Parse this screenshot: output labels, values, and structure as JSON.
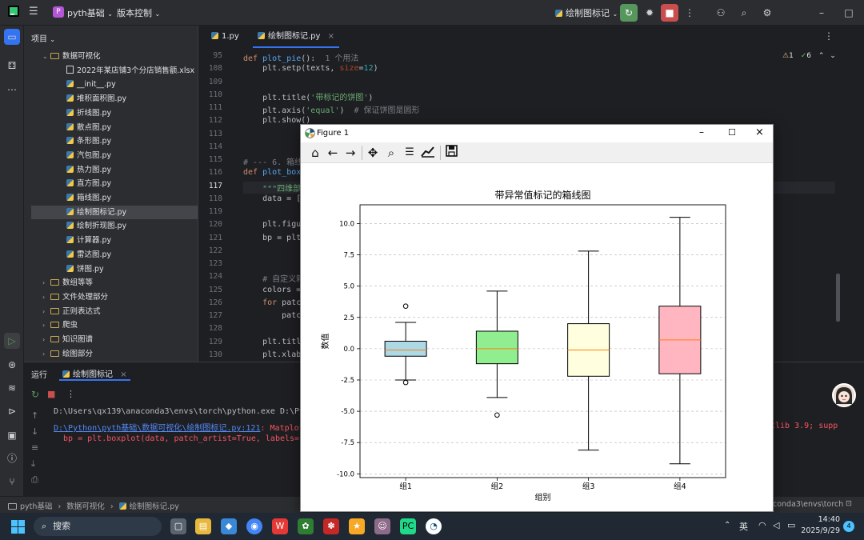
{
  "titlebar": {
    "project_badge": "P",
    "project_name": "pyth基础",
    "vcs": "版本控制",
    "run_config": "绘制图标记",
    "icons": [
      "hamburger-icon",
      "run-icon",
      "debug-icon",
      "stop-icon",
      "more-icon",
      "add-user-icon",
      "search-icon",
      "settings-icon"
    ]
  },
  "project_panel": {
    "title": "项目",
    "rows": [
      {
        "label": "数据可视化",
        "kind": "folder",
        "depth": 1,
        "expanded": true
      },
      {
        "label": "2022年某店铺3个分店销售额.xlsx",
        "kind": "xlsx",
        "depth": 2
      },
      {
        "label": "__init__.py",
        "kind": "py",
        "depth": 2
      },
      {
        "label": "堆积面积图.py",
        "kind": "py",
        "depth": 2
      },
      {
        "label": "折线图.py",
        "kind": "py",
        "depth": 2
      },
      {
        "label": "散点图.py",
        "kind": "py",
        "depth": 2
      },
      {
        "label": "条形图.py",
        "kind": "py",
        "depth": 2
      },
      {
        "label": "汽包图.py",
        "kind": "py",
        "depth": 2
      },
      {
        "label": "热力图.py",
        "kind": "py",
        "depth": 2
      },
      {
        "label": "直方图.py",
        "kind": "py",
        "depth": 2
      },
      {
        "label": "箱线图.py",
        "kind": "py",
        "depth": 2
      },
      {
        "label": "绘制图标记.py",
        "kind": "py",
        "depth": 2,
        "selected": true
      },
      {
        "label": "绘制折现图.py",
        "kind": "py",
        "depth": 2
      },
      {
        "label": "计算器.py",
        "kind": "py",
        "depth": 2
      },
      {
        "label": "雷达图.py",
        "kind": "py",
        "depth": 2
      },
      {
        "label": "饼图.py",
        "kind": "py",
        "depth": 2
      },
      {
        "label": "数组等等",
        "kind": "folder",
        "depth": 1
      },
      {
        "label": "文件处理部分",
        "kind": "folder",
        "depth": 1
      },
      {
        "label": "正则表达式",
        "kind": "folder",
        "depth": 1
      },
      {
        "label": "爬虫",
        "kind": "folder",
        "depth": 1
      },
      {
        "label": "知识图谱",
        "kind": "folder",
        "depth": 1
      },
      {
        "label": "绘图部分",
        "kind": "folder",
        "depth": 1
      }
    ]
  },
  "editor": {
    "tabs": [
      {
        "label": "1.py",
        "active": false
      },
      {
        "label": "绘制图标记.py",
        "active": true
      }
    ],
    "inspections": {
      "warnings": "1",
      "ok": "6"
    },
    "line_numbers": [
      "95",
      "108",
      "109",
      "110",
      "111",
      "112",
      "113",
      "114",
      "115",
      "116",
      "117",
      "118",
      "119",
      "120",
      "121",
      "122",
      "123",
      "124",
      "125",
      "126",
      "127",
      "128",
      "129",
      "130"
    ],
    "lines": [
      [
        [
          "kw",
          "def "
        ],
        [
          "fn",
          "plot_pie"
        ],
        [
          "",
          "():  "
        ],
        [
          "cmt",
          "1 个用法"
        ]
      ],
      [
        [
          "",
          "    plt.setp(texts, "
        ],
        [
          "prm",
          "size"
        ],
        [
          "",
          "="
        ],
        [
          "num",
          "12"
        ],
        [
          "",
          ")"
        ]
      ],
      [
        [
          "",
          ""
        ]
      ],
      [
        [
          "",
          "    plt.title("
        ],
        [
          "str",
          "'带标记的饼图'"
        ],
        [
          "",
          ")"
        ]
      ],
      [
        [
          "",
          "    plt.axis("
        ],
        [
          "str",
          "'equal'"
        ],
        [
          "",
          ")  "
        ],
        [
          "cmt",
          "# 保证饼图是圆形"
        ]
      ],
      [
        [
          "",
          "    plt.show()"
        ]
      ],
      [
        [
          "",
          ""
        ]
      ],
      [
        [
          "",
          ""
        ]
      ],
      [
        [
          "cmt",
          "# --- 6. 箱线"
        ]
      ],
      [
        [
          "kw",
          "def "
        ],
        [
          "fn",
          "plot_box"
        ]
      ],
      [
        [
          "str",
          "    \"\"\"四维部"
        ]
      ],
      [
        [
          "",
          "    data = ["
        ]
      ],
      [
        [
          "",
          ""
        ]
      ],
      [
        [
          "",
          "    plt.figu"
        ]
      ],
      [
        [
          "",
          "    bp = plt"
        ]
      ],
      [
        [
          "",
          ""
        ]
      ],
      [
        [
          "",
          ""
        ]
      ],
      [
        [
          "cmt",
          "    # 自定义箱"
        ]
      ],
      [
        [
          "",
          "    colors ="
        ]
      ],
      [
        [
          "kw",
          "    for "
        ],
        [
          "",
          "patc"
        ]
      ],
      [
        [
          "",
          "        patc"
        ]
      ],
      [
        [
          "",
          ""
        ]
      ],
      [
        [
          "",
          "    plt.titl"
        ]
      ],
      [
        [
          "",
          "    plt.xlab"
        ]
      ]
    ]
  },
  "run_panel": {
    "title": "运行",
    "tab": "绘制图标记",
    "lines": [
      {
        "text": "D:\\Users\\qx139\\anaconda3\\envs\\torch\\python.exe D:\\Py",
        "color": "#bcbec4"
      },
      {
        "text": "D:\\Python\\pyth基础\\数据可视化\\绘制图标记.py:121",
        "color": "#548af7",
        "suffix": ": Matplotl",
        "suffix_color": "#f75464"
      },
      {
        "text": "  bp = plt.boxplot(data, patch_artist=True, labels=[",
        "color": "#f75464"
      }
    ],
    "right_overflow": "tlib 3.9; supp"
  },
  "statusbar": {
    "crumbs": [
      "pyth基础",
      "数据可视化",
      "绘制图标记.py"
    ],
    "right": "conda3\\envs\\torch"
  },
  "taskbar": {
    "search": "搜索",
    "ime": "英",
    "time": "14:40",
    "date": "2025/9/29",
    "notifications": "4"
  },
  "figure": {
    "title": "Figure 1",
    "toolbar": [
      "home-icon",
      "back-icon",
      "forward-icon",
      "pan-icon",
      "zoom-icon",
      "configure-icon",
      "edit-axis-icon",
      "save-icon"
    ]
  },
  "chart_data": {
    "type": "box",
    "title": "带异常值标记的箱线图",
    "xlabel": "组别",
    "ylabel": "数值",
    "categories": [
      "组1",
      "组2",
      "组3",
      "组4"
    ],
    "ylim": [
      -10.3,
      11.5
    ],
    "yticks": [
      -10.0,
      -7.5,
      -5.0,
      -2.5,
      0.0,
      2.5,
      5.0,
      7.5,
      10.0
    ],
    "ytick_labels": [
      "-10.0",
      "-7.5",
      "-5.0",
      "-2.5",
      "0.0",
      "2.5",
      "5.0",
      "7.5",
      "10.0"
    ],
    "grid": "y-dashed",
    "boxes": [
      {
        "name": "组1",
        "whisker_low": -2.5,
        "q1": -0.6,
        "median": -0.1,
        "q3": 0.6,
        "whisker_high": 2.1,
        "outliers": [
          3.4,
          -2.7
        ],
        "color": "#add8e6"
      },
      {
        "name": "组2",
        "whisker_low": -3.9,
        "q1": -1.2,
        "median": 0.0,
        "q3": 1.4,
        "whisker_high": 4.6,
        "outliers": [
          -5.3
        ],
        "color": "#90ee90"
      },
      {
        "name": "组3",
        "whisker_low": -8.1,
        "q1": -2.2,
        "median": -0.1,
        "q3": 2.0,
        "whisker_high": 7.8,
        "outliers": [],
        "color": "#ffffe0"
      },
      {
        "name": "组4",
        "whisker_low": -9.2,
        "q1": -2.0,
        "median": 0.7,
        "q3": 3.4,
        "whisker_high": 10.5,
        "outliers": [],
        "color": "#ffb6c1"
      }
    ],
    "median_color": "#ff7f0e"
  }
}
